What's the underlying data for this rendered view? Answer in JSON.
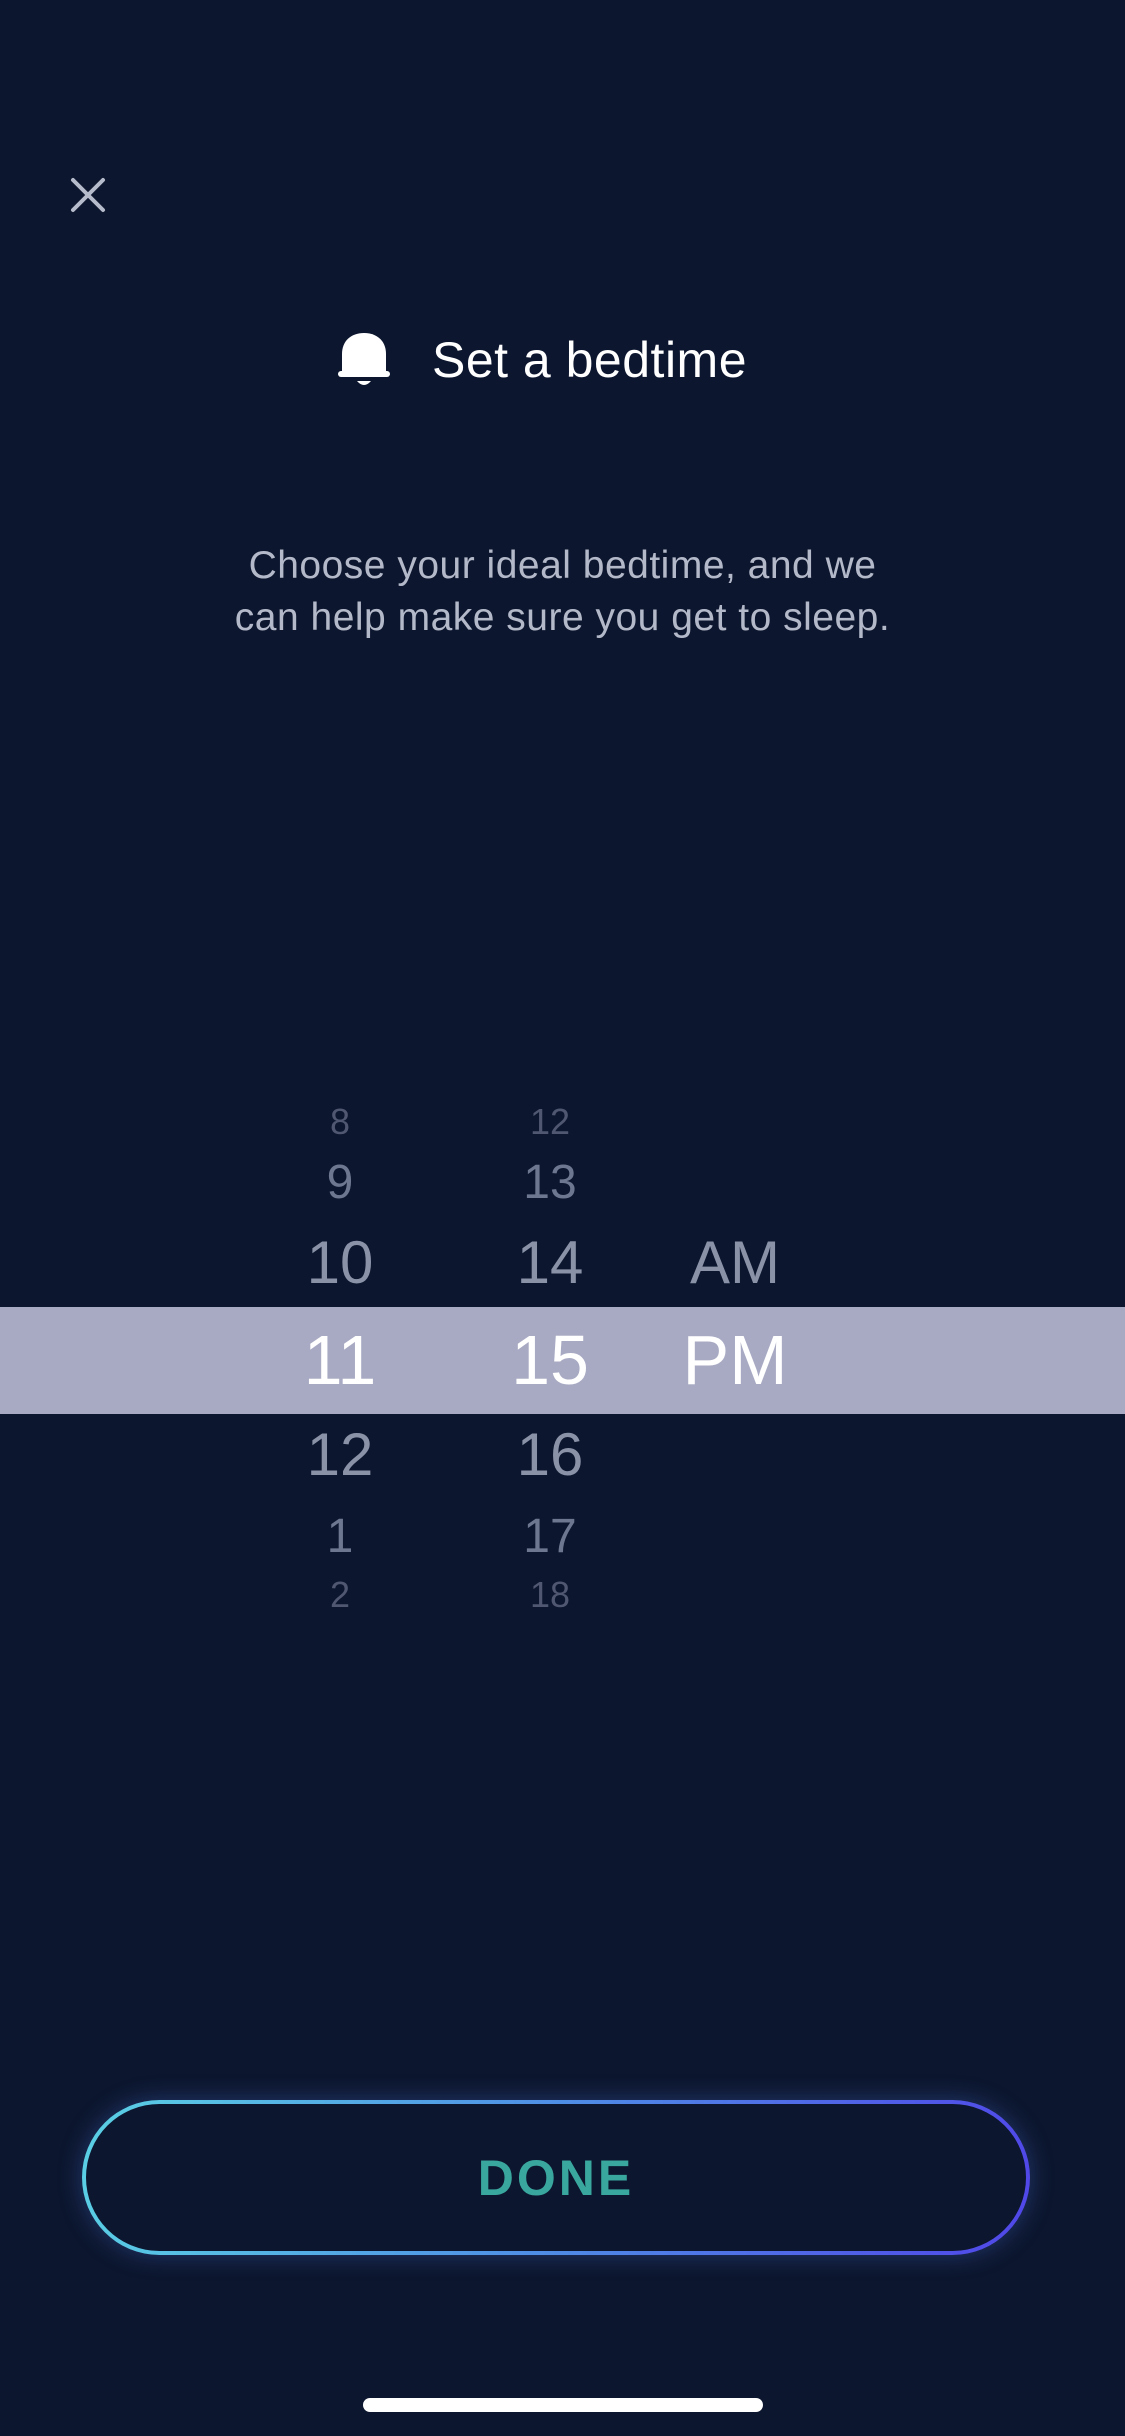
{
  "header": {
    "title": "Set a bedtime",
    "icon": "bell-icon"
  },
  "close": {
    "icon": "close-icon"
  },
  "subtitle": {
    "line1": "Choose your ideal bedtime, and we",
    "line2": "can help make sure you get to sleep."
  },
  "picker": {
    "hours": {
      "above": [
        "8",
        "9",
        "10"
      ],
      "selected": "11",
      "below": [
        "12",
        "1",
        "2"
      ]
    },
    "minutes": {
      "above": [
        "12",
        "13",
        "14"
      ],
      "selected": "15",
      "below": [
        "16",
        "17",
        "18"
      ]
    },
    "period": {
      "above": [
        "AM"
      ],
      "selected": "PM"
    }
  },
  "done_button": {
    "label": "DONE"
  },
  "colors": {
    "background": "#0c162e",
    "highlight": "#a8aac3",
    "done_text": "#3aa79f",
    "gradient_start": "#5ad0e4",
    "gradient_end": "#5046e8"
  }
}
